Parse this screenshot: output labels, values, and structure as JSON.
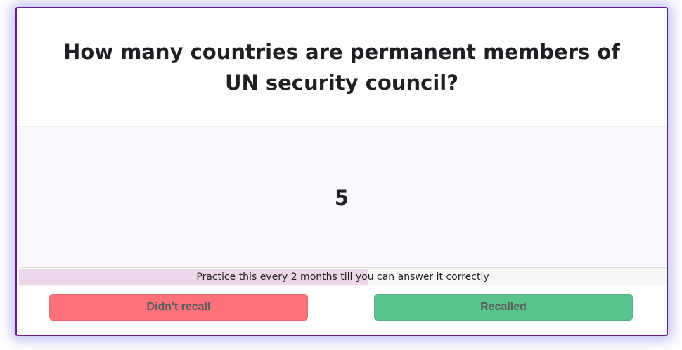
{
  "card": {
    "question": "How many countries are permanent members of UN security council?",
    "answer": "5"
  },
  "progress": {
    "label": "Practice this every 2 months till you can answer it correctly",
    "fraction": 0.54
  },
  "actions": {
    "fail_label": "Didn't recall",
    "pass_label": "Recalled"
  },
  "colors": {
    "frame_border": "#6a1a8a",
    "answer_background": "#fbf8ff",
    "progress_fill": "#ecd8ea",
    "fail_button": "#fd7279",
    "pass_button": "#5ac48e"
  }
}
